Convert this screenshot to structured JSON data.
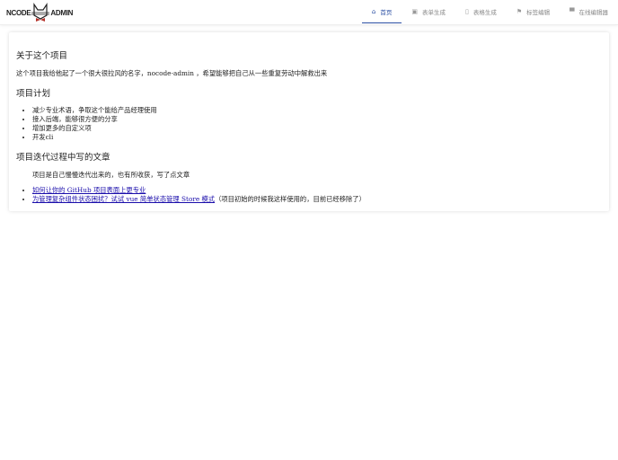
{
  "header": {
    "logo": {
      "left": "NCODE",
      "right": "ADMIN"
    },
    "nav": [
      {
        "label": "首页",
        "icon": "home-icon",
        "active": true
      },
      {
        "label": "表单生成",
        "icon": "form-icon",
        "active": false
      },
      {
        "label": "表格生成",
        "icon": "table-icon",
        "active": false
      },
      {
        "label": "标签编辑",
        "icon": "flag-icon",
        "active": false
      },
      {
        "label": "在线编辑器",
        "icon": "monitor-icon",
        "active": false
      }
    ]
  },
  "main": {
    "about_title": "关于这个项目",
    "about_text": "这个项目我给他起了一个很大很拉风的名字，nocode-admin ，希望能够把自己从一些重复劳动中解救出来",
    "plan_title": "项目计划",
    "plan_items": [
      "减少专业术语，争取这个能给产品经理使用",
      "接入后端，能够很方便的分享",
      "增加更多的自定义项",
      "开发cli"
    ],
    "articles_title": "项目迭代过程中写的文章",
    "articles_intro": "项目是自己慢慢迭代出来的，也有所收获，写了点文章",
    "articles": [
      {
        "link": "如何让你的 GitHub 项目表面上更专业",
        "note": ""
      },
      {
        "link": "为管理复杂组件状态困扰？试试 vue 简单状态管理 Store 模式",
        "note": "（项目初始的时候我这样使用的，目前已经移除了）"
      }
    ]
  }
}
